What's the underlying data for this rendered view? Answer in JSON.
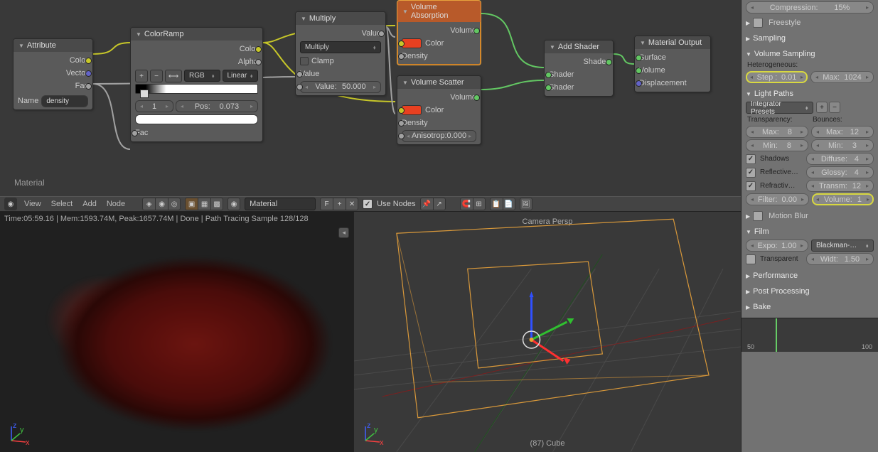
{
  "nodes": {
    "attribute": {
      "title": "Attribute",
      "out_color": "Color",
      "out_vector": "Vector",
      "out_fac": "Fac",
      "name_label": "Name",
      "name_value": "density"
    },
    "colorramp": {
      "title": "ColorRamp",
      "out_color": "Color",
      "out_alpha": "Alpha",
      "mode": "RGB",
      "interp": "Linear",
      "index": "1",
      "pos_label": "Pos:",
      "pos_val": "0.073",
      "in_fac": "Fac"
    },
    "multiply": {
      "title": "Multiply",
      "out_value": "Value",
      "op": "Multiply",
      "clamp": "Clamp",
      "in_value": "Value",
      "val_label": "Value:",
      "val_num": "50.000"
    },
    "volabs": {
      "title": "Volume Absorption",
      "out_volume": "Volume",
      "in_color": "Color",
      "in_density": "Density"
    },
    "volscat": {
      "title": "Volume Scatter",
      "out_volume": "Volume",
      "in_color": "Color",
      "in_density": "Density",
      "aniso_label": "Anisotrop:",
      "aniso_val": "0.000"
    },
    "addshader": {
      "title": "Add Shader",
      "out_shader": "Shader",
      "in_shader1": "Shader",
      "in_shader2": "Shader"
    },
    "matout": {
      "title": "Material Output",
      "in_surface": "Surface",
      "in_volume": "Volume",
      "in_disp": "Displacement"
    }
  },
  "mat_label": "Material",
  "header": {
    "view": "View",
    "select": "Select",
    "add": "Add",
    "node": "Node",
    "material": "Material",
    "usenodes": "Use Nodes"
  },
  "render": {
    "info": "Time:05:59.16 | Mem:1593.74M, Peak:1657.74M | Done | Path Tracing Sample 128/128"
  },
  "viewport": {
    "cam": "Camera Persp",
    "obj": "(87) Cube",
    "timeline_start": "50",
    "timeline_end": "100"
  },
  "props": {
    "compression_label": "Compression:",
    "compression_val": "15%",
    "freestyle": "Freestyle",
    "sampling": "Sampling",
    "volsamp": "Volume Sampling",
    "hetero": "Heterogeneous:",
    "step_label": "Step :",
    "step_val": "0.01",
    "max_label": "Max:",
    "max_val": "1024",
    "lightpaths": "Light Paths",
    "presets": "Integrator Presets",
    "transparency": "Transparency:",
    "bounces": "Bounces:",
    "tmax_l": "Max:",
    "tmax_v": "8",
    "tmin_l": "Min:",
    "tmin_v": "8",
    "bmax_l": "Max:",
    "bmax_v": "12",
    "bmin_l": "Min:",
    "bmin_v": "3",
    "shadows": "Shadows",
    "reflective": "Reflective…",
    "refractive": "Refractiv…",
    "diffuse_l": "Diffuse:",
    "diffuse_v": "4",
    "glossy_l": "Glossy:",
    "glossy_v": "4",
    "transm_l": "Transm:",
    "transm_v": "12",
    "volume_l": "Volume:",
    "volume_v": "1",
    "filter_l": "Filter:",
    "filter_v": "0.00",
    "motionblur": "Motion Blur",
    "film": "Film",
    "expo_l": "Expo:",
    "expo_v": "1.00",
    "pixfilter": "Blackman-…",
    "width_l": "Widt:",
    "width_v": "1.50",
    "transparent": "Transparent",
    "performance": "Performance",
    "postproc": "Post Processing",
    "bake": "Bake"
  }
}
